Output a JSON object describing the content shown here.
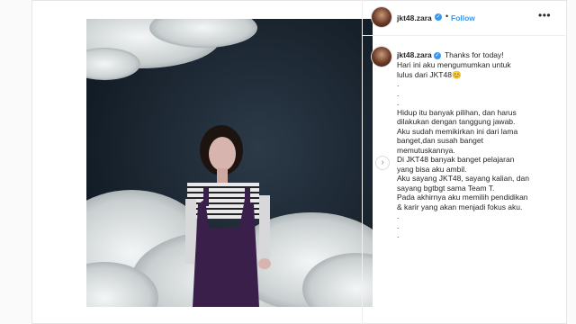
{
  "post": {
    "username": "jkt48.zara",
    "follow_label": "Follow",
    "separator": "•",
    "more_label": "•••",
    "next_arrow": "›",
    "verified_mark": "✓",
    "caption_first_line": "Thanks for today!",
    "caption_body": "Hari ini aku mengumumkan untuk\nlulus dari JKT48😊\n.\n.\n.\nHidup itu banyak pilihan, dan harus\ndilakukan dengan tanggung jawab.\nAku sudah memikirkan ini dari lama\nbanget,dan susah banget\nmemutuskannya.\nDi JKT48 banyak banget pelajaran\nyang bisa aku ambil.\nAku sayang JKT48, sayang kalian, dan\nsayang bgtbgt sama Team T.\nPada akhirnya aku memilih pendidikan\n& karir yang akan menjadi fokus aku.\n.\n.\n."
  },
  "colors": {
    "accent": "#3897f0",
    "text": "#262626",
    "border": "#efefef"
  },
  "icons": {
    "verified": "verified-badge-icon",
    "more": "more-options-icon",
    "next": "chevron-right-icon"
  }
}
